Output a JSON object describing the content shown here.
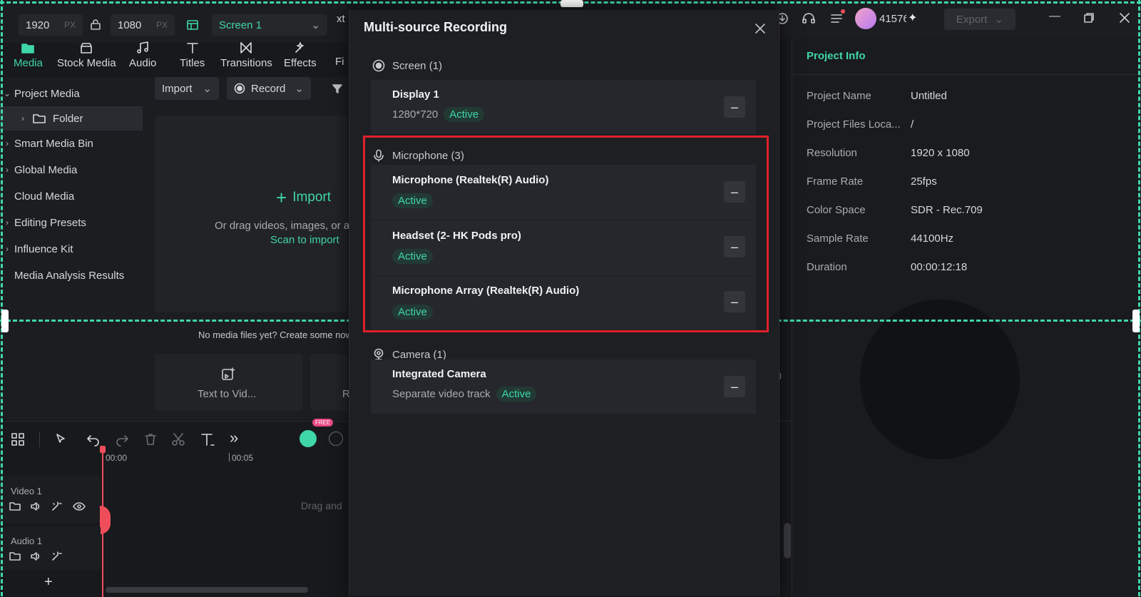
{
  "topbar": {
    "width_value": "1920",
    "height_value": "1080",
    "unit": "PX",
    "screen_select": "Screen 1",
    "partial_label": "xt",
    "credits": "41576"
  },
  "toolbar": {
    "items": [
      {
        "label": "Media"
      },
      {
        "label": "Stock Media"
      },
      {
        "label": "Audio"
      },
      {
        "label": "Titles"
      },
      {
        "label": "Transitions"
      },
      {
        "label": "Effects"
      },
      {
        "label": "Fi"
      }
    ]
  },
  "sidebar": {
    "items": [
      {
        "label": "Project Media"
      },
      {
        "label": "Folder"
      },
      {
        "label": "Smart Media Bin"
      },
      {
        "label": "Global Media"
      },
      {
        "label": "Cloud Media"
      },
      {
        "label": "Editing Presets"
      },
      {
        "label": "Influence Kit"
      },
      {
        "label": "Media Analysis Results"
      }
    ]
  },
  "media": {
    "import_btn": "Import",
    "record_btn": "Record",
    "import_big": "Import",
    "drag_text": "Or drag videos, images, or a",
    "scan_link": "Scan to import",
    "no_media": "No media files yet? Create some now",
    "text_to_video": "Text to Vid...",
    "partial_r": "R"
  },
  "timeline": {
    "time_0": "00:00",
    "time_5": "00:05",
    "video_track": "Video 1",
    "audio_track": "Audio 1",
    "drag_hint": "Drag and",
    "free_badge": "FREE",
    "partial_0": "0"
  },
  "project_info": {
    "title": "Project Info",
    "rows": [
      {
        "key": "Project Name",
        "value": "Untitled"
      },
      {
        "key": "Project Files Loca...",
        "value": "/"
      },
      {
        "key": "Resolution",
        "value": "1920 x 1080"
      },
      {
        "key": "Frame Rate",
        "value": "25fps"
      },
      {
        "key": "Color Space",
        "value": "SDR - Rec.709"
      },
      {
        "key": "Sample Rate",
        "value": "44100Hz"
      },
      {
        "key": "Duration",
        "value": "00:00:12:18"
      }
    ]
  },
  "export": {
    "label": "Export"
  },
  "modal": {
    "title": "Multi-source Recording",
    "screen_section": "Screen (1)",
    "display": {
      "name": "Display 1",
      "resolution": "1280*720",
      "status": "Active"
    },
    "mic_section": "Microphone (3)",
    "mics": [
      {
        "name": "Microphone (Realtek(R) Audio)",
        "status": "Active"
      },
      {
        "name": "Headset (2- HK Pods pro)",
        "status": "Active"
      },
      {
        "name": "Microphone Array (Realtek(R) Audio)",
        "status": "Active"
      }
    ],
    "camera_section": "Camera (1)",
    "camera": {
      "name": "Integrated Camera",
      "sub": "Separate video track",
      "status": "Active"
    },
    "minus": "–"
  },
  "colors": {
    "accent": "#3fd6a8",
    "highlight": "#e0202a",
    "background": "#18191c"
  }
}
